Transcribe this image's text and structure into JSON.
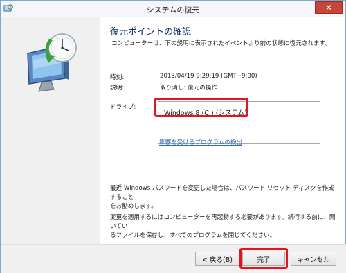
{
  "window": {
    "title": "システムの復元"
  },
  "main": {
    "heading": "復元ポイントの確認",
    "intro": "コンピューターは、下の説明に表示されたイベントより前の状態に復元されます。",
    "time_label": "時刻:",
    "time_value": "2013/04/19 9:29:19 (GMT+9:00)",
    "description_label": "説明:",
    "description_value": "取り消し: 復元の操作",
    "drives_label": "ドライブ:",
    "drives": [
      "Windows 8 (C:) (システム)"
    ],
    "affected_link": "影響を受けるプログラムの検出",
    "note1_line1": "最近 Windows パスワードを変更した場合は、パスワード リセット ディスクを作成すること",
    "note1_line2": "をお勧めします。",
    "note2_line1": "変更を適用するにはコンピューターを再起動する必要があります。続行する前に、開いてい",
    "note2_line2": "るファイルを保存し、すべてのプログラムを閉じてください。"
  },
  "footer": {
    "back_label": "< 戻る(B)",
    "finish_label": "完了",
    "cancel_label": "キャンセル"
  },
  "icons": {
    "title": "system-restore-icon",
    "illustration": "computer-restore-clock-icon",
    "close": "close-icon"
  },
  "colors": {
    "highlight": "#e3141e",
    "heading": "#0a2a66",
    "link": "#2c6cc0",
    "close": "#c7463a"
  }
}
